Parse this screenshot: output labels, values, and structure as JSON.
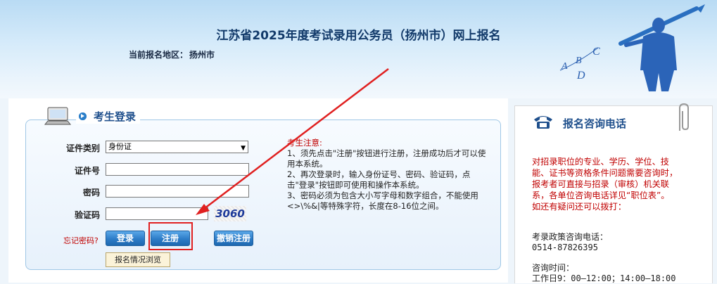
{
  "header": {
    "title": "江苏省2025年度考试录用公务员（扬州市）网上报名",
    "region_label": "当前报名地区：",
    "region_value": "扬州市",
    "decor_letters": [
      "A",
      "B",
      "C",
      "D"
    ]
  },
  "login": {
    "section_title": "考生登录",
    "id_type_label": "证件类别",
    "id_type_value": "身份证",
    "id_number_label": "证件号",
    "id_number_value": "",
    "password_label": "密码",
    "password_value": "",
    "captcha_label": "验证码",
    "captcha_value": "",
    "captcha_image_text": "3060",
    "forgot_label": "忘记密码?",
    "login_button": "登录",
    "register_button": "注册",
    "cancel_register_button": "撤销注册",
    "browse_button": "报名情况浏览"
  },
  "notice": {
    "title": "考生注意:",
    "lines": [
      "1、须先点击\"注册\"按钮进行注册，注册成功后才可以使用本系统。",
      "2、再次登录时，输入身份证号、密码、验证码，点击\"登录\"按钮即可使用和操作本系统。",
      "3、密码必须为包含大小写字母和数字组合，不能使用<>\\%&|等特殊字符，长度在8-16位之间。"
    ]
  },
  "contact": {
    "title": "报名咨询电话",
    "red_text": "对招录职位的专业、学历、学位、技能、证书等资格条件问题需要咨询时，报考者可直接与招录（审核）机关联系，各单位咨询电话详见“职位表”。",
    "red_text2": "如还有疑问还可以拨打：",
    "policy_label": "考录政策咨询电话：",
    "policy_phone": "0514-87826395",
    "hours_label": "咨询时间：",
    "hours_value": "工作日9：00—12:00；14:00—18:00"
  },
  "colors": {
    "accent": "#1e4f8c",
    "button": "#2d7cc7",
    "warning": "#c00000",
    "highlight": "#e02020"
  }
}
